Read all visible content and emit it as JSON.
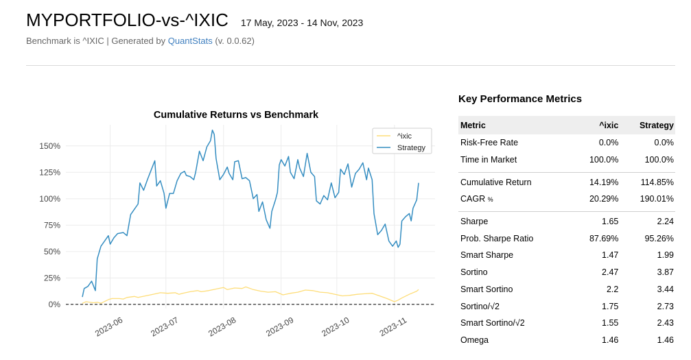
{
  "header": {
    "title": "MYPORTFOLIO-vs-^IXIC",
    "date_range": "17 May, 2023 - 14 Nov, 2023",
    "subtitle_prefix": "Benchmark is ^IXIC | Generated by ",
    "subtitle_link": "QuantStats",
    "subtitle_suffix": " (v. 0.0.62)"
  },
  "chart_data": {
    "type": "line",
    "title": "Cumulative Returns vs Benchmark",
    "xlabel": "",
    "ylabel": "",
    "ylim": [
      0,
      165
    ],
    "y_ticks": [
      0,
      25,
      50,
      75,
      100,
      125,
      150
    ],
    "y_tick_format": "{}%",
    "x_ticks": [
      "2023-06",
      "2023-07",
      "2023-08",
      "2023-09",
      "2023-10",
      "2023-11"
    ],
    "x_range": [
      "2023-05-17",
      "2023-11-14"
    ],
    "legend_position": "top-right",
    "grid": true,
    "series": [
      {
        "name": "^ixic",
        "color": "#fedd78",
        "points": [
          [
            "2023-05-17",
            1.0
          ],
          [
            "2023-05-19",
            2.5
          ],
          [
            "2023-05-23",
            1.5
          ],
          [
            "2023-05-25",
            2.0
          ],
          [
            "2023-05-27",
            1.0
          ],
          [
            "2023-05-31",
            4.5
          ],
          [
            "2023-06-02",
            5.5
          ],
          [
            "2023-06-06",
            5.5
          ],
          [
            "2023-06-08",
            5.0
          ],
          [
            "2023-06-10",
            6.5
          ],
          [
            "2023-06-14",
            7.5
          ],
          [
            "2023-06-16",
            6.5
          ],
          [
            "2023-06-20",
            8.0
          ],
          [
            "2023-06-24",
            9.5
          ],
          [
            "2023-06-28",
            11.0
          ],
          [
            "2023-07-02",
            10.5
          ],
          [
            "2023-07-06",
            11.0
          ],
          [
            "2023-07-08",
            9.5
          ],
          [
            "2023-07-10",
            10.5
          ],
          [
            "2023-07-14",
            12.0
          ],
          [
            "2023-07-18",
            13.0
          ],
          [
            "2023-07-20",
            12.0
          ],
          [
            "2023-07-24",
            13.0
          ],
          [
            "2023-07-28",
            14.5
          ],
          [
            "2023-08-01",
            16.0
          ],
          [
            "2023-08-03",
            14.0
          ],
          [
            "2023-08-07",
            15.5
          ],
          [
            "2023-08-11",
            15.0
          ],
          [
            "2023-08-13",
            16.5
          ],
          [
            "2023-08-17",
            14.0
          ],
          [
            "2023-08-21",
            12.5
          ],
          [
            "2023-08-25",
            11.5
          ],
          [
            "2023-08-29",
            12.0
          ],
          [
            "2023-09-02",
            9.0
          ],
          [
            "2023-09-06",
            10.5
          ],
          [
            "2023-09-10",
            11.5
          ],
          [
            "2023-09-14",
            13.5
          ],
          [
            "2023-09-18",
            13.0
          ],
          [
            "2023-09-22",
            11.5
          ],
          [
            "2023-09-26",
            11.0
          ],
          [
            "2023-09-30",
            9.5
          ],
          [
            "2023-10-04",
            8.0
          ],
          [
            "2023-10-08",
            8.5
          ],
          [
            "2023-10-12",
            9.5
          ],
          [
            "2023-10-16",
            10.0
          ],
          [
            "2023-10-20",
            10.5
          ],
          [
            "2023-10-24",
            8.0
          ],
          [
            "2023-10-28",
            5.5
          ],
          [
            "2023-11-01",
            2.5
          ],
          [
            "2023-11-03",
            4.0
          ],
          [
            "2023-11-05",
            6.0
          ],
          [
            "2023-11-09",
            9.5
          ],
          [
            "2023-11-13",
            12.5
          ],
          [
            "2023-11-14",
            14.0
          ]
        ]
      },
      {
        "name": "Strategy",
        "color": "#348dc1",
        "points": [
          [
            "2023-05-17",
            7
          ],
          [
            "2023-05-18",
            15
          ],
          [
            "2023-05-20",
            17
          ],
          [
            "2023-05-22",
            22
          ],
          [
            "2023-05-24",
            13
          ],
          [
            "2023-05-25",
            43
          ],
          [
            "2023-05-27",
            55
          ],
          [
            "2023-05-29",
            60
          ],
          [
            "2023-05-31",
            65
          ],
          [
            "2023-06-01",
            57
          ],
          [
            "2023-06-03",
            63
          ],
          [
            "2023-06-05",
            67
          ],
          [
            "2023-06-08",
            68
          ],
          [
            "2023-06-10",
            65
          ],
          [
            "2023-06-12",
            85
          ],
          [
            "2023-06-14",
            90
          ],
          [
            "2023-06-16",
            95
          ],
          [
            "2023-06-17",
            115
          ],
          [
            "2023-06-19",
            108
          ],
          [
            "2023-06-21",
            118
          ],
          [
            "2023-06-23",
            127
          ],
          [
            "2023-06-25",
            136
          ],
          [
            "2023-06-26",
            112
          ],
          [
            "2023-06-28",
            117
          ],
          [
            "2023-06-30",
            105
          ],
          [
            "2023-07-01",
            91
          ],
          [
            "2023-07-03",
            105
          ],
          [
            "2023-07-05",
            105
          ],
          [
            "2023-07-07",
            117
          ],
          [
            "2023-07-09",
            124
          ],
          [
            "2023-07-11",
            126
          ],
          [
            "2023-07-12",
            122
          ],
          [
            "2023-07-14",
            121
          ],
          [
            "2023-07-16",
            118
          ],
          [
            "2023-07-17",
            125
          ],
          [
            "2023-07-19",
            145
          ],
          [
            "2023-07-21",
            136
          ],
          [
            "2023-07-23",
            149
          ],
          [
            "2023-07-25",
            155
          ],
          [
            "2023-07-26",
            165
          ],
          [
            "2023-07-27",
            161
          ],
          [
            "2023-07-28",
            138
          ],
          [
            "2023-07-30",
            118
          ],
          [
            "2023-08-01",
            123
          ],
          [
            "2023-08-03",
            130
          ],
          [
            "2023-08-04",
            124
          ],
          [
            "2023-08-06",
            118
          ],
          [
            "2023-08-07",
            135
          ],
          [
            "2023-08-09",
            136
          ],
          [
            "2023-08-11",
            119
          ],
          [
            "2023-08-13",
            120
          ],
          [
            "2023-08-15",
            117
          ],
          [
            "2023-08-17",
            100
          ],
          [
            "2023-08-19",
            104
          ],
          [
            "2023-08-20",
            88
          ],
          [
            "2023-08-22",
            97
          ],
          [
            "2023-08-24",
            80
          ],
          [
            "2023-08-26",
            72
          ],
          [
            "2023-08-27",
            88
          ],
          [
            "2023-08-29",
            99
          ],
          [
            "2023-08-30",
            106
          ],
          [
            "2023-08-31",
            132
          ],
          [
            "2023-09-01",
            137
          ],
          [
            "2023-09-03",
            131
          ],
          [
            "2023-09-05",
            140
          ],
          [
            "2023-09-06",
            125
          ],
          [
            "2023-09-08",
            119
          ],
          [
            "2023-09-10",
            137
          ],
          [
            "2023-09-11",
            129
          ],
          [
            "2023-09-13",
            121
          ],
          [
            "2023-09-15",
            143
          ],
          [
            "2023-09-17",
            125
          ],
          [
            "2023-09-19",
            121
          ],
          [
            "2023-09-20",
            98
          ],
          [
            "2023-09-22",
            95
          ],
          [
            "2023-09-24",
            103
          ],
          [
            "2023-09-26",
            99
          ],
          [
            "2023-09-28",
            115
          ],
          [
            "2023-09-30",
            101
          ],
          [
            "2023-10-02",
            106
          ],
          [
            "2023-10-03",
            128
          ],
          [
            "2023-10-05",
            123
          ],
          [
            "2023-10-07",
            133
          ],
          [
            "2023-10-09",
            111
          ],
          [
            "2023-10-11",
            124
          ],
          [
            "2023-10-13",
            128
          ],
          [
            "2023-10-15",
            134
          ],
          [
            "2023-10-17",
            118
          ],
          [
            "2023-10-18",
            129
          ],
          [
            "2023-10-20",
            118
          ],
          [
            "2023-10-21",
            86
          ],
          [
            "2023-10-23",
            66
          ],
          [
            "2023-10-25",
            70
          ],
          [
            "2023-10-27",
            76
          ],
          [
            "2023-10-29",
            60
          ],
          [
            "2023-10-31",
            55
          ],
          [
            "2023-11-02",
            60
          ],
          [
            "2023-11-03",
            54
          ],
          [
            "2023-11-04",
            57
          ],
          [
            "2023-11-05",
            79
          ],
          [
            "2023-11-07",
            83
          ],
          [
            "2023-11-09",
            86
          ],
          [
            "2023-11-10",
            79
          ],
          [
            "2023-11-11",
            91
          ],
          [
            "2023-11-13",
            99
          ],
          [
            "2023-11-14",
            115
          ]
        ]
      }
    ]
  },
  "kpi": {
    "title": "Key Performance Metrics",
    "headers": [
      "Metric",
      "^ixic",
      "Strategy"
    ],
    "groups": [
      [
        {
          "metric": "Risk-Free Rate",
          "bench": "0.0%",
          "strat": "0.0%"
        },
        {
          "metric": "Time in Market",
          "bench": "100.0%",
          "strat": "100.0%"
        }
      ],
      [
        {
          "metric": "Cumulative Return",
          "bench": "14.19%",
          "strat": "114.85%"
        },
        {
          "metric": "CAGR",
          "metric_suffix": "%",
          "bench": "20.29%",
          "strat": "190.01%"
        }
      ],
      [
        {
          "metric": "Sharpe",
          "bench": "1.65",
          "strat": "2.24"
        },
        {
          "metric": "Prob. Sharpe Ratio",
          "bench": "87.69%",
          "strat": "95.26%"
        },
        {
          "metric": "Smart Sharpe",
          "bench": "1.47",
          "strat": "1.99"
        },
        {
          "metric": "Sortino",
          "bench": "2.47",
          "strat": "3.87"
        },
        {
          "metric": "Smart Sortino",
          "bench": "2.2",
          "strat": "3.44"
        },
        {
          "metric": "Sortino/√2",
          "bench": "1.75",
          "strat": "2.73"
        },
        {
          "metric": "Smart Sortino/√2",
          "bench": "1.55",
          "strat": "2.43"
        },
        {
          "metric": "Omega",
          "bench": "1.46",
          "strat": "1.46"
        }
      ]
    ]
  }
}
